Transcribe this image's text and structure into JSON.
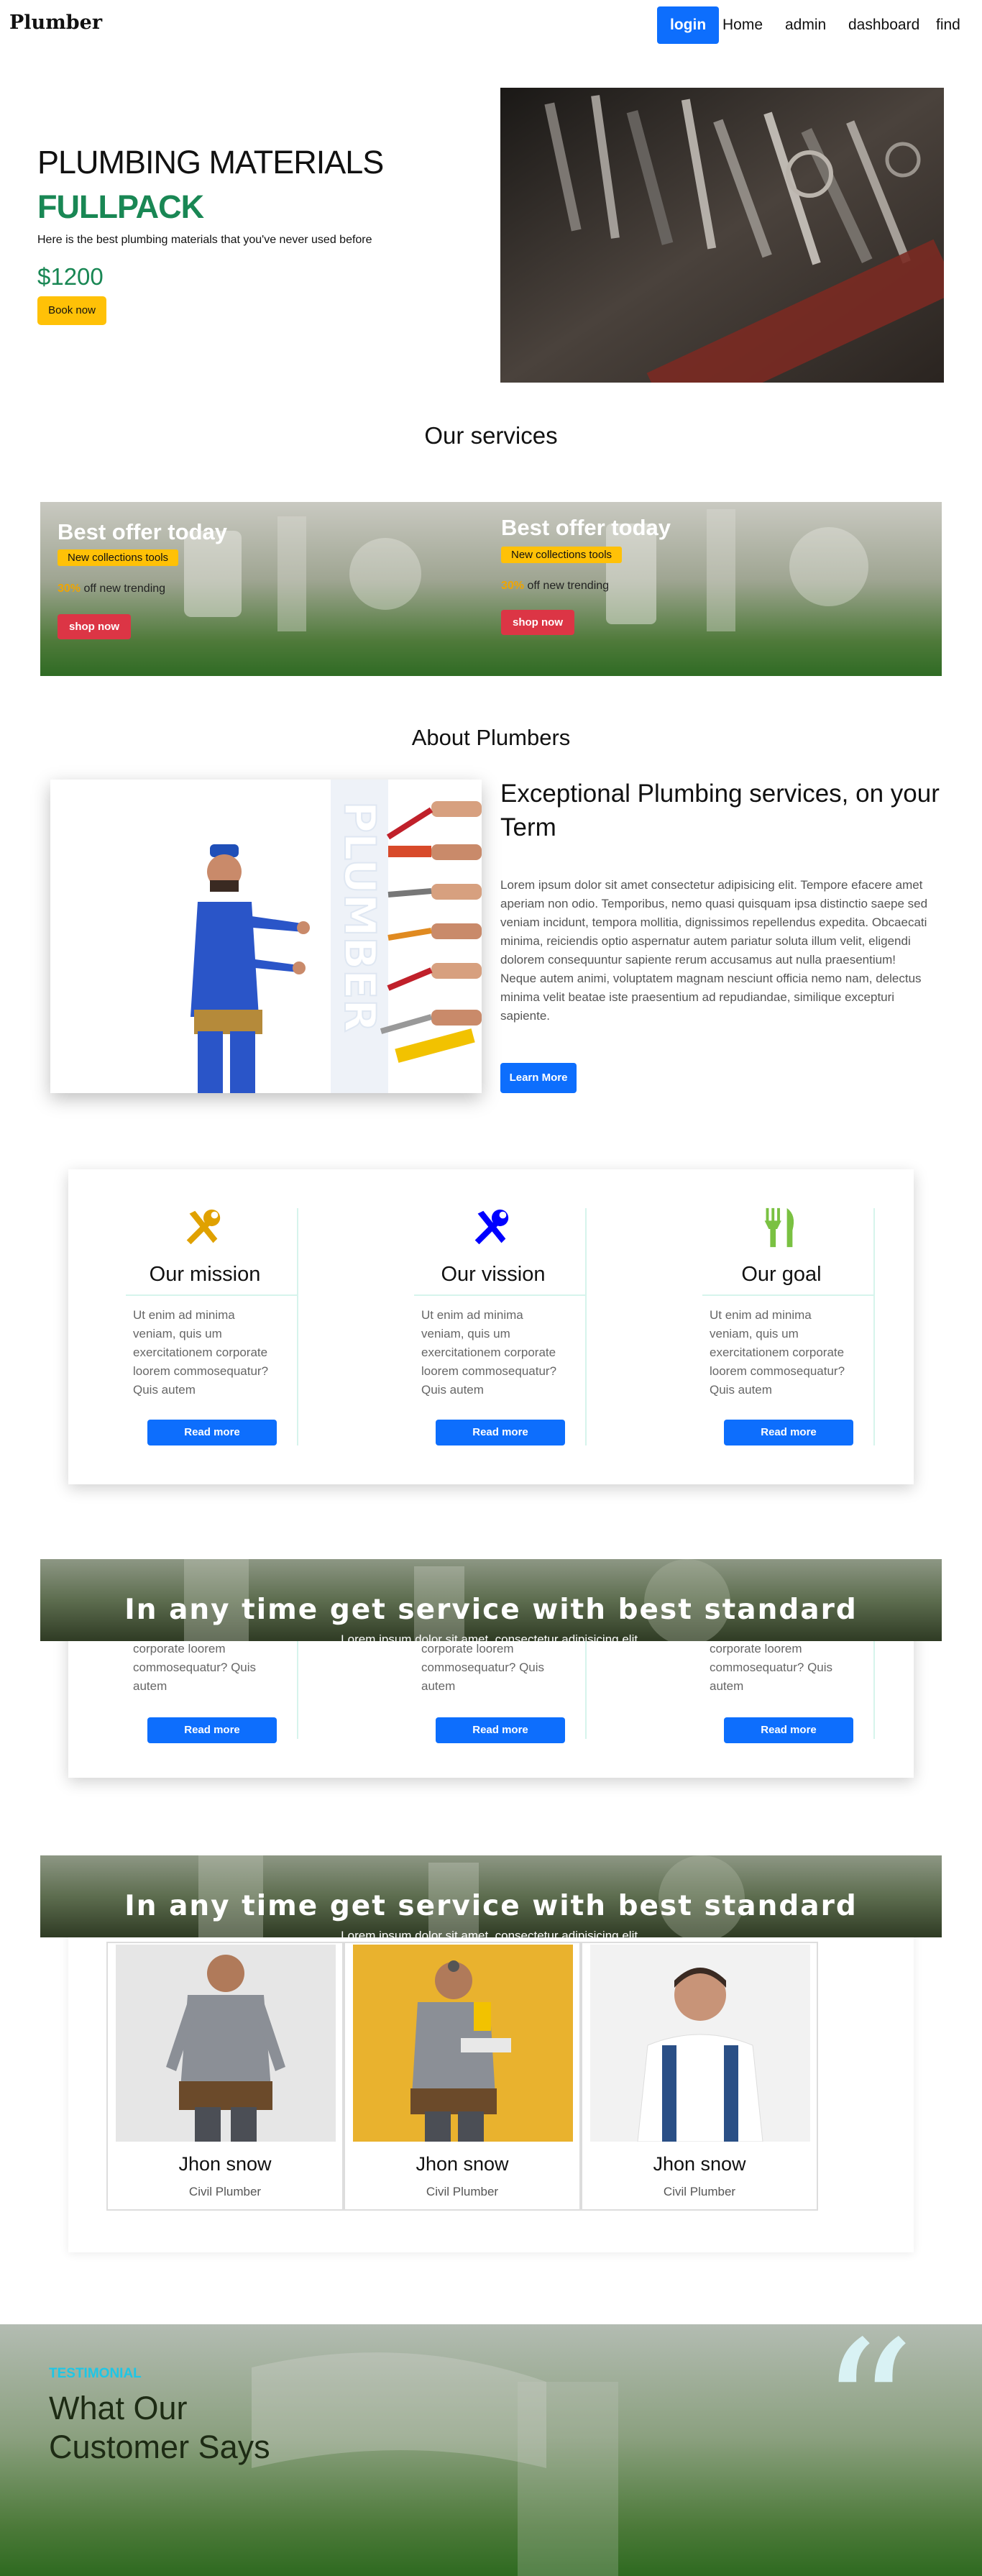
{
  "nav": {
    "brand": "Plumber",
    "login": "login",
    "home": "Home",
    "admin": "admin",
    "dashboard": "dashboard",
    "find": "find"
  },
  "hero": {
    "title": "PLUMBING MATERIALS",
    "subtitle": "FULLPACK",
    "description": "Here is the best plumbing materials that you've never used before",
    "price": "$1200",
    "button": "Book now"
  },
  "services": {
    "title": "Our services",
    "offers": [
      {
        "title": "Best offer today",
        "badge": "New collections tools",
        "discount": "30%",
        "discount_text": "off new trending",
        "button": "shop now"
      },
      {
        "title": "Best offer today",
        "badge": "New collections tools",
        "discount": "30%",
        "discount_text": "off new trending",
        "button": "shop now"
      }
    ]
  },
  "about": {
    "title": "About Plumbers",
    "image_word": "PLUMBER",
    "heading": "Exceptional Plumbing services, on your Term",
    "text": "Lorem ipsum dolor sit amet consectetur adipisicing elit. Tempore efacere amet aperiam non odio. Temporibus, nemo quasi quisquam ipsa distinctio saepe sed veniam incidunt, tempora mollitia, dignissimos repellendus expedita. Obcaecati minima, reiciendis optio aspernatur autem pariatur soluta illum velit, eligendi dolorem consequuntur sapiente rerum accusamus aut nulla praesentium! Neque autem animi, voluptatem magnam nesciunt officia nemo nam, delectus minima velit beatae iste praesentium ad repudiandae, similique excepturi sapiente.",
    "button": "Learn More"
  },
  "cards": [
    {
      "title": "Our mission",
      "text": "Ut enim ad minima veniam, quis um exercitationem corporate loorem commosequatur? Quis autem",
      "button": "Read more",
      "icon": "tools-icon",
      "icon_color": "#e0a100"
    },
    {
      "title": "Our vission",
      "text": "Ut enim ad minima veniam, quis um exercitationem corporate loorem commosequatur? Quis autem",
      "button": "Read more",
      "icon": "tools-icon",
      "icon_color": "#0000ff"
    },
    {
      "title": "Our goal",
      "text": "Ut enim ad minima veniam, quis um exercitationem corporate loorem commosequatur? Quis autem",
      "button": "Read more",
      "icon": "utensils-icon",
      "icon_color": "#7ac142"
    }
  ],
  "cards_repeat": [
    {
      "text": "corporate loorem commosequatur? Quis autem",
      "button": "Read more"
    },
    {
      "text": "corporate loorem commosequatur? Quis autem",
      "button": "Read more"
    },
    {
      "text": "corporate loorem commosequatur? Quis autem",
      "button": "Read more"
    }
  ],
  "banner": {
    "title": "In any time get service with best standard",
    "subtitle": "Lorem ipsum dolor sit amet, consectetur adipisicing elit."
  },
  "team": [
    {
      "name": "Jhon snow",
      "role": "Civil Plumber"
    },
    {
      "name": "Jhon snow",
      "role": "Civil Plumber"
    },
    {
      "name": "Jhon snow",
      "role": "Civil Plumber"
    }
  ],
  "testimonial": {
    "tag": "TESTIMONIAL",
    "title": "What Our Customer Says",
    "quote_mark": "“"
  },
  "colors": {
    "primary": "#0d6efd",
    "success": "#198754",
    "warning": "#ffc107",
    "danger": "#dc3545",
    "cyan": "#1ec6e6"
  }
}
